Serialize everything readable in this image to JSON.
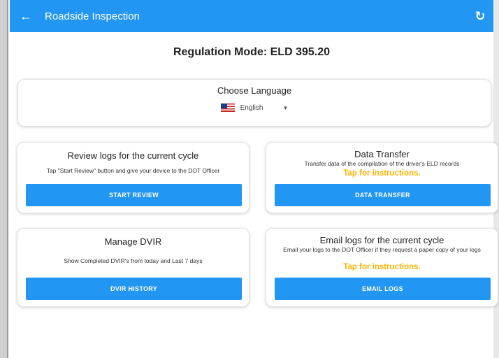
{
  "appbar": {
    "back_icon": "arrow-left-icon",
    "title": "Roadside Inspection",
    "refresh_icon": "refresh-icon",
    "color": "#2196f3"
  },
  "regulation_mode": "Regulation Mode: ELD 395.20",
  "language": {
    "heading": "Choose Language",
    "flag_icon": "us-flag-icon",
    "selected": "English"
  },
  "review": {
    "title": "Review logs for the current cycle",
    "description": "Tap \"Start Review\" button and give your device to the DOT Officer",
    "button": "START REVIEW"
  },
  "data_transfer": {
    "title": "Data Transfer",
    "description": "Transfer data of the compilation of the driver's ELD records",
    "link": "Tap for instructions.",
    "button": "DATA TRANSFER"
  },
  "dvir": {
    "title": "Manage DVIR",
    "description": "Show Completed DVIR's from today and Last 7 days",
    "button": "DVIR HISTORY"
  },
  "email": {
    "title": "Email logs for the current cycle",
    "description": "Email your logs to the DOT Officer if they request a paper copy of your logs",
    "link": "Tap for instructions.",
    "button": "EMAIL LOGS"
  },
  "colors": {
    "primary": "#2196f3",
    "link": "#ffb300"
  }
}
